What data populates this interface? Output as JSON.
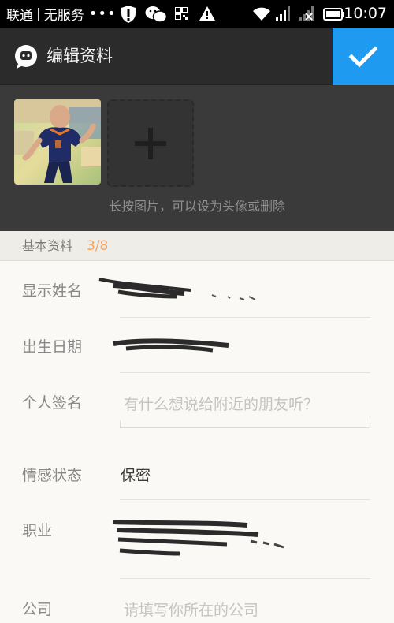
{
  "status_bar": {
    "carrier": "联通",
    "separator": "|",
    "service": "无服务",
    "dots": "•••",
    "time": "10:07",
    "icons": [
      "shield-alert-icon",
      "wechat-icon",
      "qr-icon",
      "warning-icon",
      "wifi-icon",
      "signal-icon",
      "signal-off-icon",
      "battery-icon"
    ]
  },
  "header": {
    "title": "编辑资料",
    "logo_icon": "app-chat-logo-icon",
    "confirm_icon": "checkmark-icon",
    "accent": "#1e9af1"
  },
  "photos": {
    "hint": "长按图片，可以设为头像或删除",
    "add_icon": "plus-icon"
  },
  "section": {
    "title": "基本资料",
    "count": "3/8",
    "count_color": "#f3a261"
  },
  "form": {
    "display_name_label": "显示姓名",
    "birthday_label": "出生日期",
    "signature_label": "个人签名",
    "signature_placeholder": "有什么想说给附近的朋友听？",
    "relationship_label": "情感状态",
    "relationship_value": "保密",
    "job_label": "职业",
    "company_label": "公司",
    "company_placeholder": "请填写你所在的公司"
  }
}
